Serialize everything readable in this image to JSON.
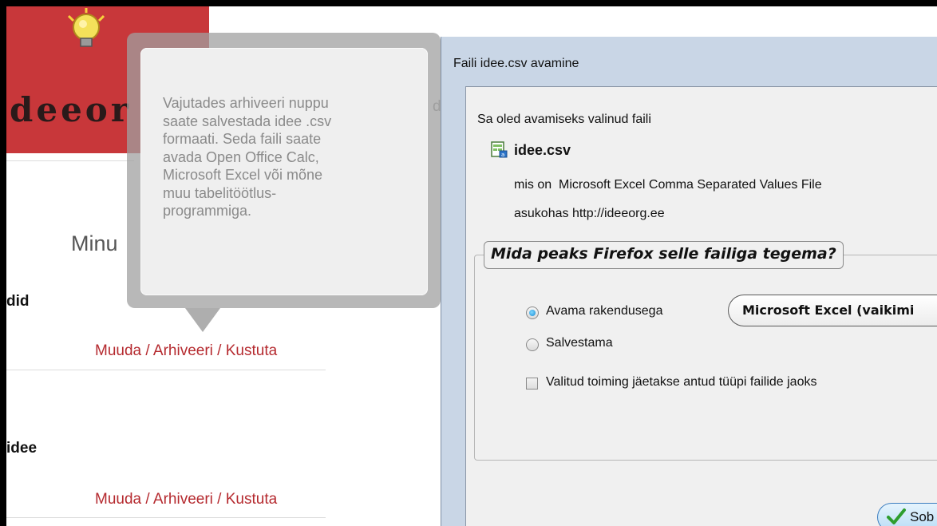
{
  "webpage": {
    "logo_text": "deeor",
    "heading": "Minu",
    "ghost_letter": "d",
    "sections": [
      {
        "title": "did",
        "actions": [
          "Muuda",
          "Arhiveeri",
          "Kustuta"
        ]
      },
      {
        "title": "idee",
        "actions": [
          "Muuda",
          "Arhiveeri",
          "Kustuta"
        ]
      }
    ],
    "separator": " / "
  },
  "tooltip": {
    "lines": [
      "Vajutades arhiveeri nuppu",
      "saate salvestada idee .csv",
      "formaati. Seda faili saate",
      "avada Open Office Calc,",
      "Microsoft Excel või mõne",
      "muu tabelitöötlus-",
      "programmiga."
    ]
  },
  "dialog": {
    "title": "Faili idee.csv avamine",
    "intro": "Sa oled avamiseks valinud faili",
    "file_name": "idee.csv",
    "type_label": "mis on",
    "type_value": "Microsoft Excel Comma Separated Values File",
    "location_label": "asukohas",
    "location_value": "http://ideeorg.ee",
    "group_legend": "Mida peaks Firefox selle failiga tegema?",
    "option_open": "Avama rakendusega",
    "option_save": "Salvestama",
    "app_select_value": "Microsoft Excel (vaikimi",
    "remember_label": "Valitud toiming jäetakse antud tüüpi failide jaoks",
    "ok_label": "Sob"
  },
  "colors": {
    "logo_bg": "#c8373a",
    "link": "#b52a2f",
    "tooltip_text": "#8a8a8a",
    "dialog_bg": "#f0f0f0"
  },
  "icons": {
    "logo": "lightbulb-icon",
    "file": "excel-file-icon",
    "ok": "green-checkmark-icon"
  }
}
